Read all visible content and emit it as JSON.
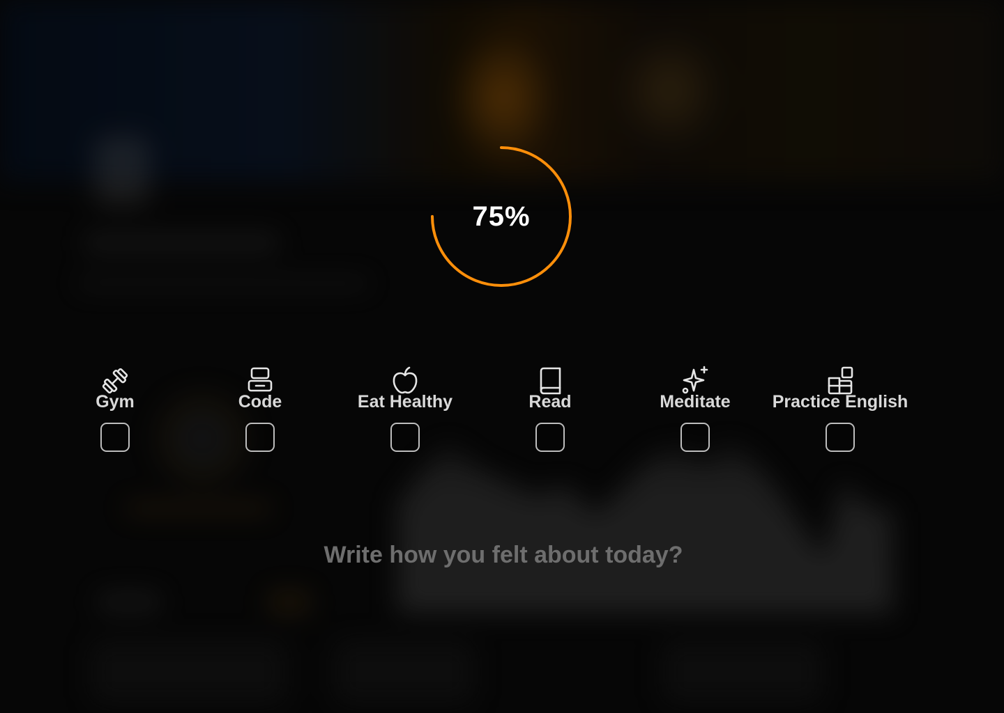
{
  "progress": {
    "value": 75,
    "label": "75%",
    "color": "#ff8f0a"
  },
  "habits": [
    {
      "label": "Gym",
      "icon": "dumbbell-icon",
      "checked": false
    },
    {
      "label": "Code",
      "icon": "code-icon",
      "checked": false
    },
    {
      "label": "Eat Healthy",
      "icon": "apple-icon",
      "checked": false
    },
    {
      "label": "Read",
      "icon": "book-icon",
      "checked": false
    },
    {
      "label": "Meditate",
      "icon": "sparkles-icon",
      "checked": false
    },
    {
      "label": "Practice English",
      "icon": "grid-plus-icon",
      "checked": false
    }
  ],
  "journal": {
    "placeholder": "Write how you felt about today?",
    "value": ""
  }
}
